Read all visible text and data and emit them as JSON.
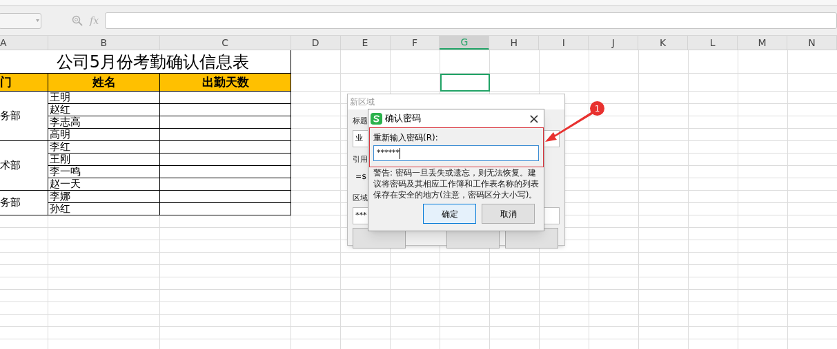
{
  "formula_bar": {
    "function_label": "fx"
  },
  "columns": [
    {
      "label": "A",
      "selected": false
    },
    {
      "label": "B",
      "selected": false
    },
    {
      "label": "C",
      "selected": false
    },
    {
      "label": "D",
      "selected": false
    },
    {
      "label": "E",
      "selected": false
    },
    {
      "label": "F",
      "selected": false
    },
    {
      "label": "G",
      "selected": true
    },
    {
      "label": "H",
      "selected": false
    },
    {
      "label": "I",
      "selected": false
    },
    {
      "label": "J",
      "selected": false
    },
    {
      "label": "K",
      "selected": false
    },
    {
      "label": "L",
      "selected": false
    },
    {
      "label": "M",
      "selected": false
    },
    {
      "label": "N",
      "selected": false
    }
  ],
  "sheet": {
    "title": "公司5月份考勤确认信息表",
    "headers": [
      "门",
      "姓名",
      "出勤天数"
    ],
    "departments": [
      {
        "name": "务部",
        "names": [
          "王明",
          "赵红",
          "李志高",
          "高明"
        ]
      },
      {
        "name": "术部",
        "names": [
          "李红",
          "王刚",
          "李一鸣",
          "赵一天"
        ]
      },
      {
        "name": "务部",
        "names": [
          "李娜",
          "孙红"
        ]
      }
    ]
  },
  "back_dialog": {
    "title": "新区域",
    "labels": [
      "标题",
      "引用",
      "区域"
    ],
    "fields": [
      "业",
      "=$",
      "***"
    ]
  },
  "dialog": {
    "title": "确认密码",
    "close": "×",
    "field_label": "重新输入密码(R):",
    "field_value": "******",
    "warning": "警告: 密码一旦丢失或遗忘，则无法恢复。建议将密码及其相应工作簿和工作表名称的列表保存在安全的地方(注意，密码区分大小写)。",
    "buttons": [
      {
        "label": "确定",
        "default": true
      },
      {
        "label": "取消",
        "default": false
      }
    ]
  },
  "annotation": {
    "badge": "1"
  }
}
